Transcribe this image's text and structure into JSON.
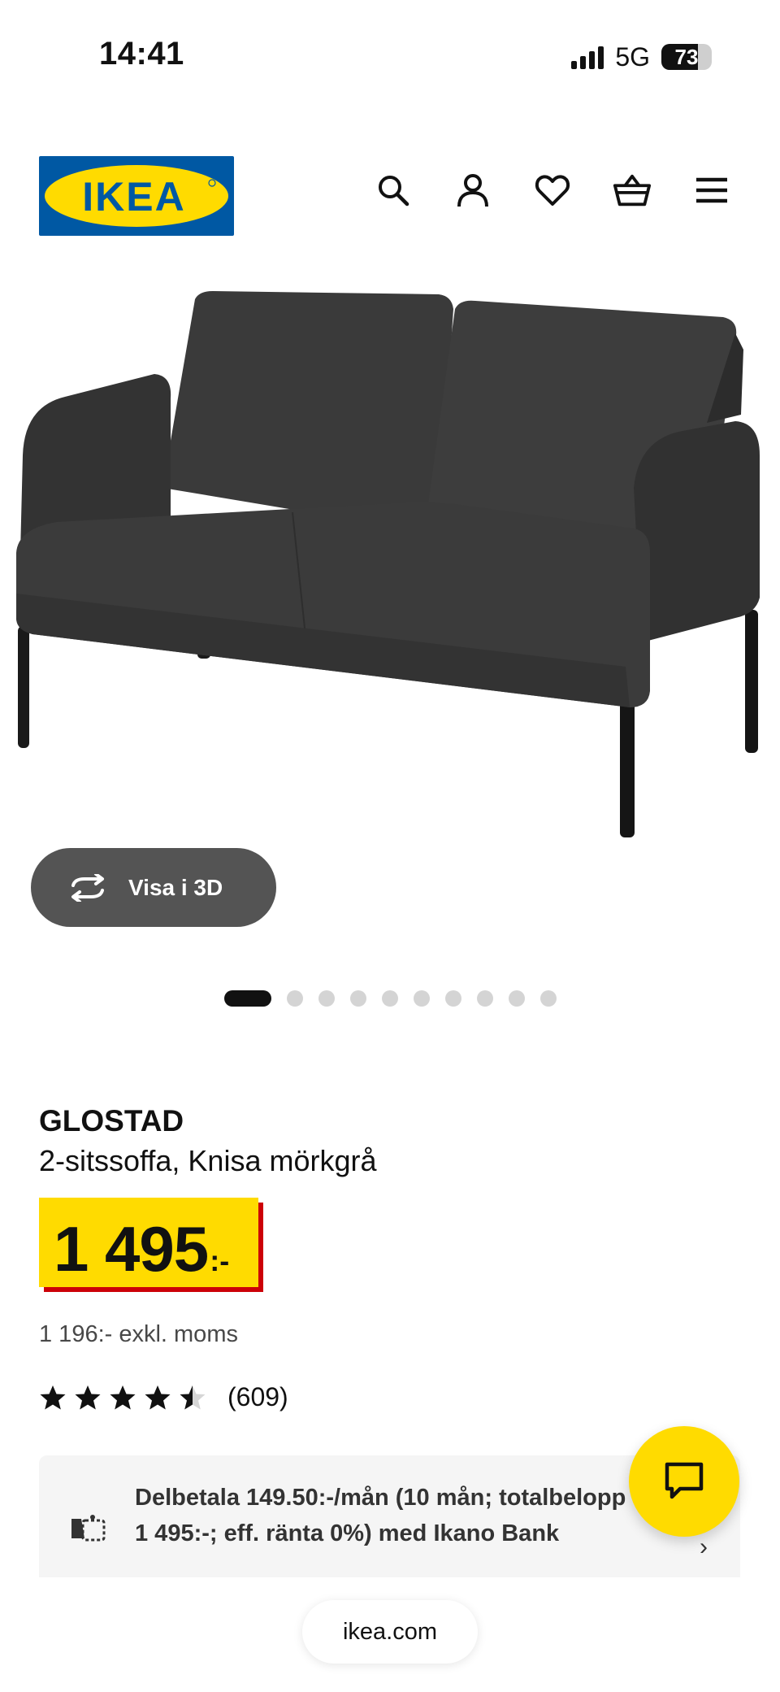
{
  "status_bar": {
    "time": "14:41",
    "network": "5G",
    "battery": "73",
    "battery_level": 0.73
  },
  "header": {
    "logo_text": "IKEA",
    "icons": [
      "search-icon",
      "account-icon",
      "heart-icon",
      "basket-icon",
      "menu-icon"
    ]
  },
  "gallery": {
    "view_3d_label": "Visa i 3D",
    "image_count": 10,
    "active_index": 0
  },
  "product": {
    "name": "GLOSTAD",
    "description": "2-sitssoffa, Knisa mörkgrå",
    "price": "1 495",
    "price_suffix": ":-",
    "price_ex_vat": "1 196:- exkl. moms",
    "rating": 4.5,
    "review_count": "(609)"
  },
  "payment": {
    "text": "Delbetala 149.50:-/mån (10 mån; totalbelopp 1 495:-; eff. ränta 0%) med Ikano Bank"
  },
  "browser": {
    "url": "ikea.com"
  },
  "colors": {
    "ikea_blue": "#0058a3",
    "ikea_yellow": "#ffdb00",
    "price_red": "#cc0008"
  }
}
